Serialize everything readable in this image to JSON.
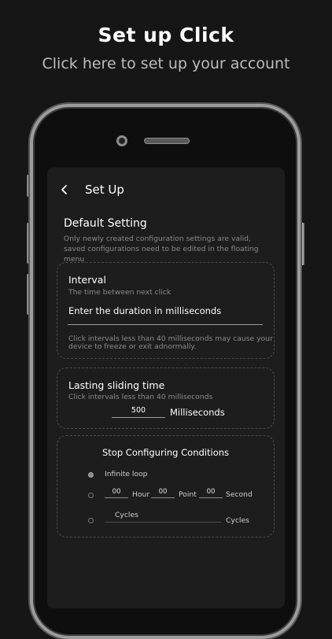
{
  "hero": {
    "title": "Set up Click",
    "subtitle": "Click here to set up your account"
  },
  "header": {
    "title": "Set Up"
  },
  "default_setting": {
    "title": "Default Setting",
    "note_line1": "Only newly created configuration settings are valid,",
    "note_line2": "saved configurations need to be edited in the floating menu"
  },
  "interval": {
    "title": "Interval",
    "subtitle": "The time between next click",
    "input_value": "Enter the duration in milliseconds",
    "warning_line1": "Click intervals less than 40 milliseconds may cause your",
    "warning_line2": "device to freeze or exit adnormally."
  },
  "sliding": {
    "title": "Lasting sliding time",
    "subtitle": "Click intervals less than 40 milliseconds",
    "value": "500",
    "unit": "Milliseconds"
  },
  "stop": {
    "title": "Stop Configuring Conditions",
    "infinite_label": "Infinite loop",
    "hour_value": "00",
    "hour_label": "Hour",
    "point_value": "00",
    "point_label": "Point",
    "second_value": "00",
    "second_label": "Second",
    "cycles_placeholder": "Cycles",
    "cycles_label": "Cycles"
  }
}
